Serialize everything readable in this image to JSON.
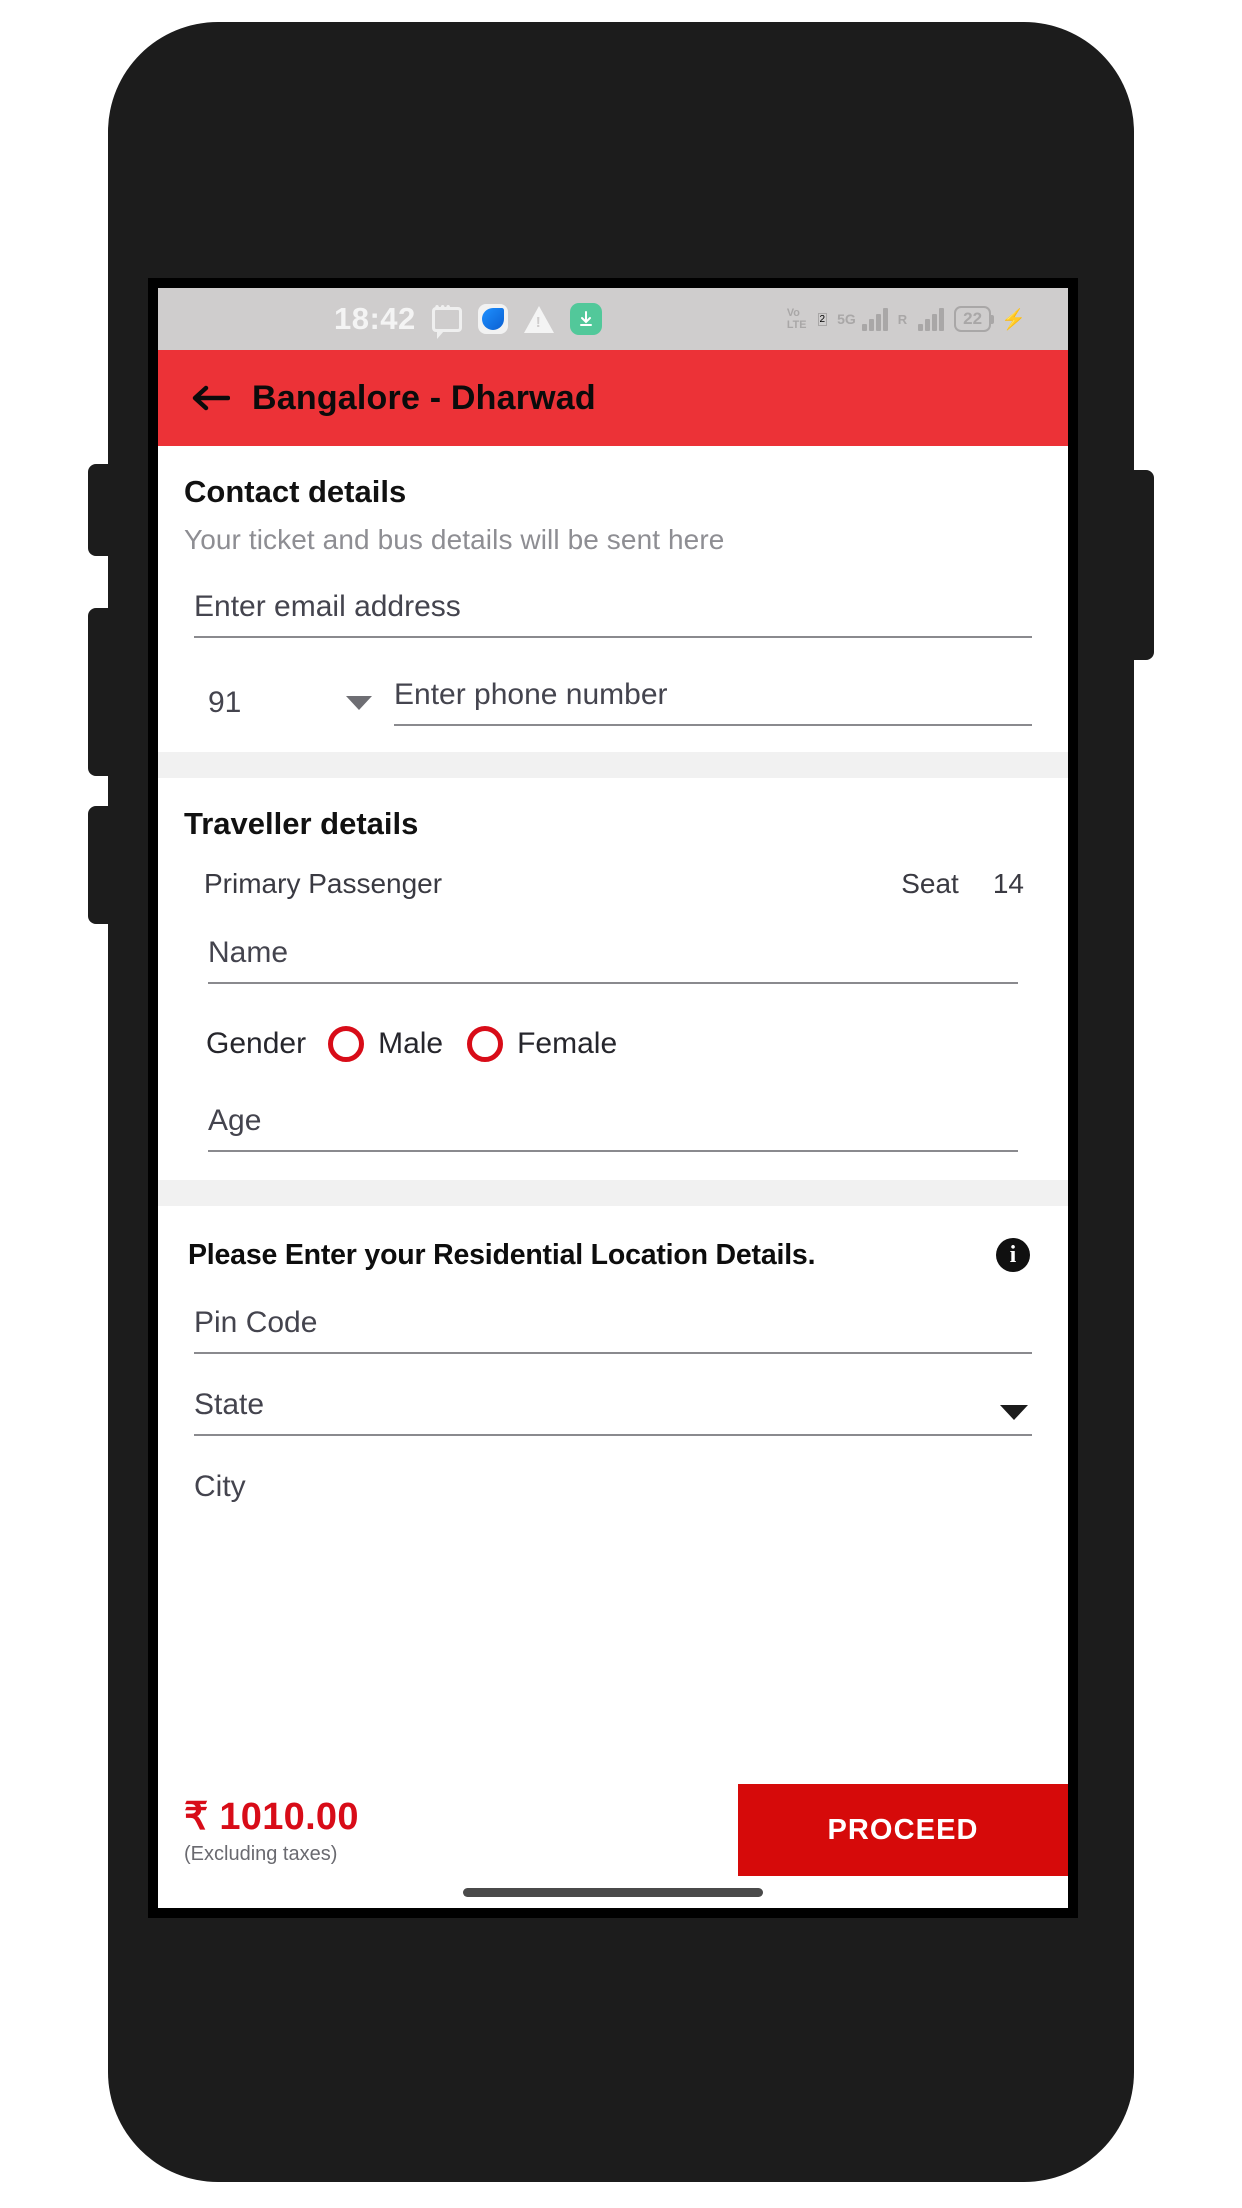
{
  "status_bar": {
    "time": "18:42",
    "icons_left": [
      "chat-icon",
      "app-icon",
      "warning-icon",
      "download-icon"
    ],
    "volte_label": "Vo",
    "volte_label2": "LTE",
    "sim_indicator": "2",
    "network_type": "5G",
    "roaming_label": "R",
    "battery_level": "22",
    "charging": "⚡"
  },
  "app_bar": {
    "title": "Bangalore - Dharwad",
    "back_icon": "back-arrow-icon",
    "bg_color": "#ec3237"
  },
  "contact": {
    "title": "Contact details",
    "subtitle": "Your ticket and bus details will be sent here",
    "email_placeholder": "Enter email address",
    "email_value": "",
    "country_code": "91",
    "phone_placeholder": "Enter phone number",
    "phone_value": ""
  },
  "traveller": {
    "title": "Traveller details",
    "passenger_label": "Primary Passenger",
    "seat_label": "Seat",
    "seat_number": "14",
    "name_placeholder": "Name",
    "name_value": "",
    "gender_label": "Gender",
    "gender_options": [
      "Male",
      "Female"
    ],
    "gender_selected": "",
    "age_placeholder": "Age",
    "age_value": ""
  },
  "residential": {
    "title": "Please Enter your Residential Location Details.",
    "info_icon": "info-icon",
    "pincode_placeholder": "Pin Code",
    "pincode_value": "",
    "state_placeholder": "State",
    "state_value": "",
    "city_placeholder": "City",
    "city_value": ""
  },
  "bottom_bar": {
    "price": "₹ 1010.00",
    "price_note": "(Excluding taxes)",
    "proceed_label": "PROCEED",
    "proceed_color": "#d60a0a",
    "price_color": "#d80c18"
  }
}
